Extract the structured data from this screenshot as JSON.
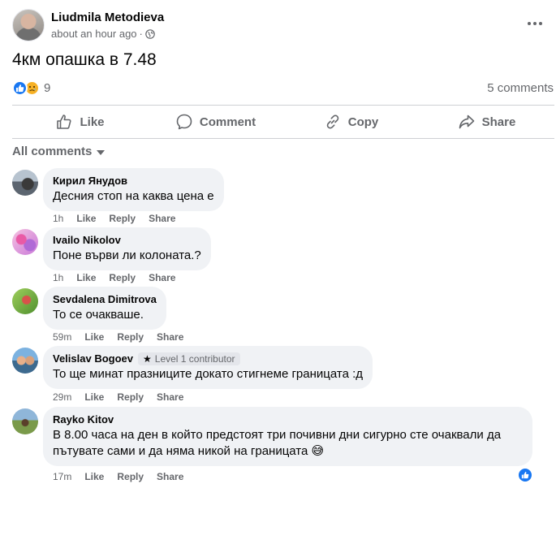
{
  "post": {
    "author": "Liudmila Metodieva",
    "time": "about an hour ago",
    "separator": "·",
    "text": "4км опашка в 7.48",
    "reaction_count": "9",
    "comments_count": "5 comments"
  },
  "actions": {
    "like": "Like",
    "comment": "Comment",
    "copy": "Copy",
    "share": "Share"
  },
  "filter": {
    "label": "All comments"
  },
  "colors": {
    "accent": "#1877f2",
    "secondary_text": "#65676b",
    "bubble_bg": "#f0f2f5"
  },
  "comments": [
    {
      "name": "Кирил Янудов",
      "text": "Десния стоп на каква цена е",
      "time": "1h",
      "like": "Like",
      "reply": "Reply",
      "share": "Share"
    },
    {
      "name": "Ivailo Nikolov",
      "text": "Поне върви ли колоната.?",
      "time": "1h",
      "like": "Like",
      "reply": "Reply",
      "share": "Share"
    },
    {
      "name": "Sevdalena Dimitrova",
      "text": "То се очакваше.",
      "time": "59m",
      "like": "Like",
      "reply": "Reply",
      "share": "Share"
    },
    {
      "name": "Velislav Bogoev",
      "badge": "Level 1 contributor",
      "text": "То ще минат празниците докато стигнеме границата :д",
      "time": "29m",
      "like": "Like",
      "reply": "Reply",
      "share": "Share"
    },
    {
      "name": "Rayko Kitov",
      "text_line1": "В 8.00 часа на ден в който предстоят три почивни дни сигурно сте очаквали да",
      "text_line2": "пътувате сами и да няма никой на границата 😅",
      "time": "17m",
      "like": "Like",
      "reply": "Reply",
      "share": "Share"
    }
  ]
}
